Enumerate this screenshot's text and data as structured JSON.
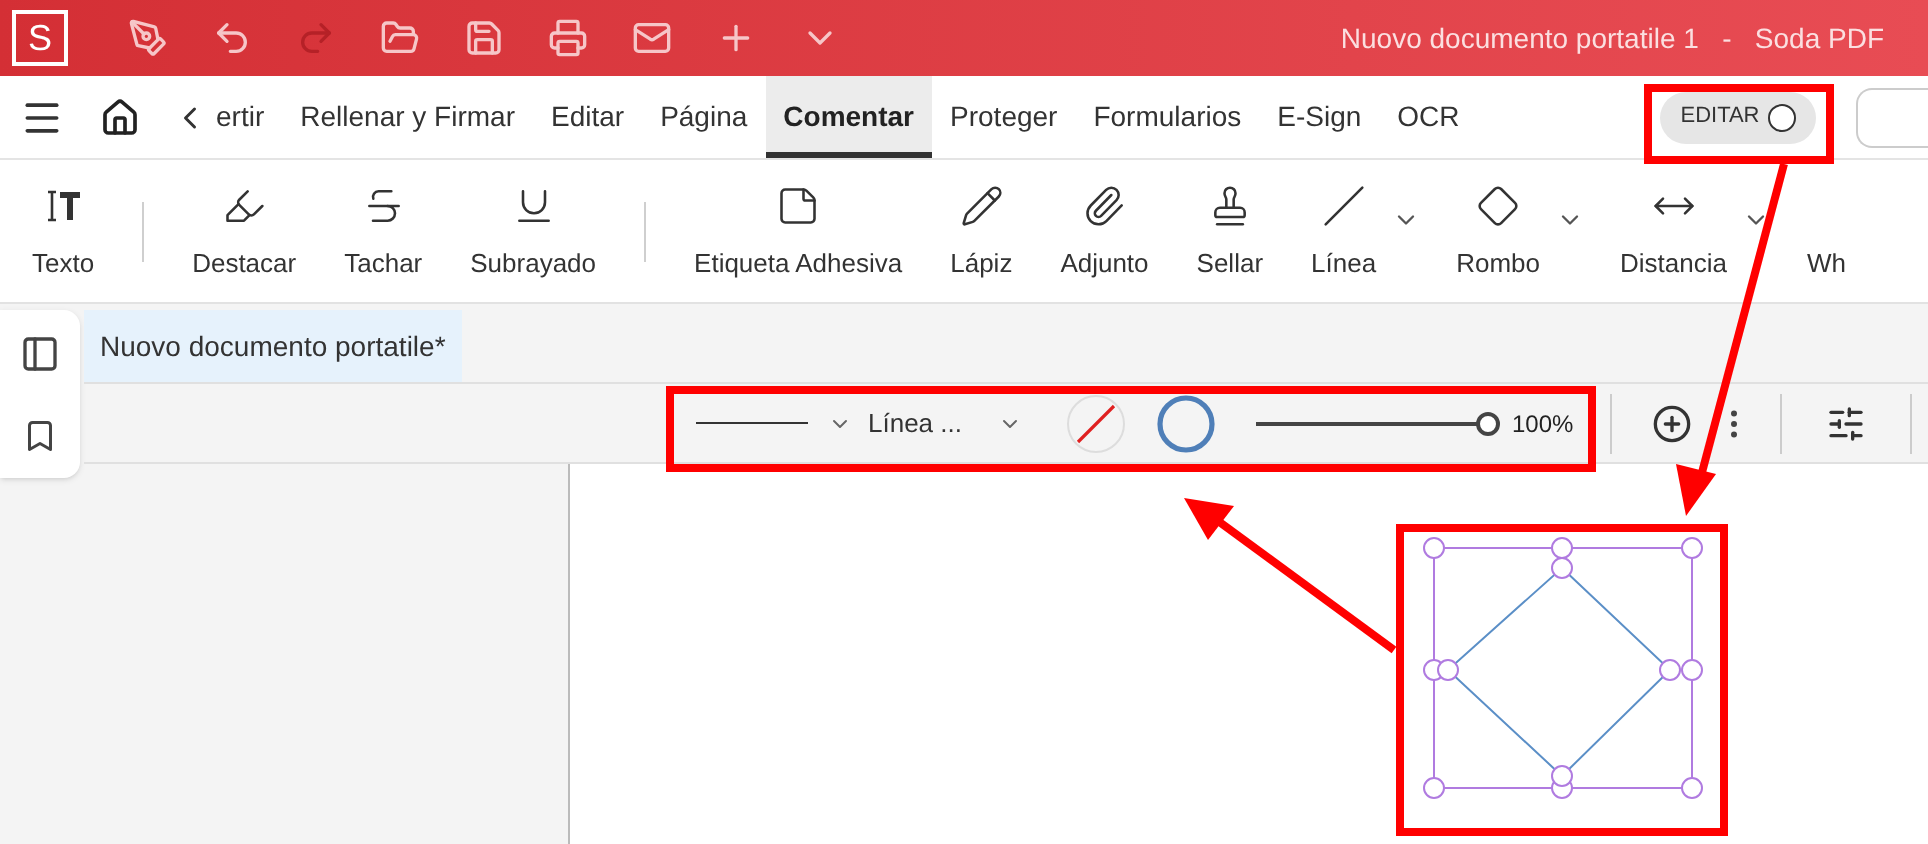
{
  "window": {
    "title": "Nuovo documento portatile 1   -   Soda PDF",
    "logo": "S"
  },
  "tabs": [
    {
      "label": "ertir",
      "selected": false
    },
    {
      "label": "Rellenar y Firmar",
      "selected": false
    },
    {
      "label": "Editar",
      "selected": false
    },
    {
      "label": "Página",
      "selected": false
    },
    {
      "label": "Comentar",
      "selected": true
    },
    {
      "label": "Proteger",
      "selected": false
    },
    {
      "label": "Formularios",
      "selected": false
    },
    {
      "label": "E-Sign",
      "selected": false
    },
    {
      "label": "OCR",
      "selected": false
    }
  ],
  "edit_toggle": {
    "label": "EDITAR",
    "on": false
  },
  "tools": [
    {
      "kind": "tool",
      "label": "Texto",
      "has_menu": false
    },
    {
      "kind": "separator"
    },
    {
      "kind": "tool",
      "label": "Destacar",
      "has_menu": false
    },
    {
      "kind": "tool",
      "label": "Tachar",
      "has_menu": false
    },
    {
      "kind": "tool",
      "label": "Subrayado",
      "has_menu": false
    },
    {
      "kind": "separator"
    },
    {
      "kind": "tool",
      "label": "Etiqueta Adhesiva",
      "has_menu": false
    },
    {
      "kind": "tool",
      "label": "Lápiz",
      "has_menu": false
    },
    {
      "kind": "tool",
      "label": "Adjunto",
      "has_menu": false
    },
    {
      "kind": "tool",
      "label": "Sellar",
      "has_menu": false
    },
    {
      "kind": "tool",
      "label": "Línea",
      "has_menu": true
    },
    {
      "kind": "tool",
      "label": "Rombo",
      "has_menu": true
    },
    {
      "kind": "tool",
      "label": "Distancia",
      "has_menu": true
    },
    {
      "kind": "tool",
      "label": "Wh",
      "has_menu": false
    }
  ],
  "document_tab": {
    "title": "Nuovo documento portatile*"
  },
  "properties": {
    "line_style": "Línea ...",
    "swatches": [
      {
        "kind": "no-fill"
      },
      {
        "kind": "outline",
        "color": "#4f7fb8"
      }
    ],
    "opacity": {
      "level": 1.0,
      "reading": "100%"
    }
  }
}
